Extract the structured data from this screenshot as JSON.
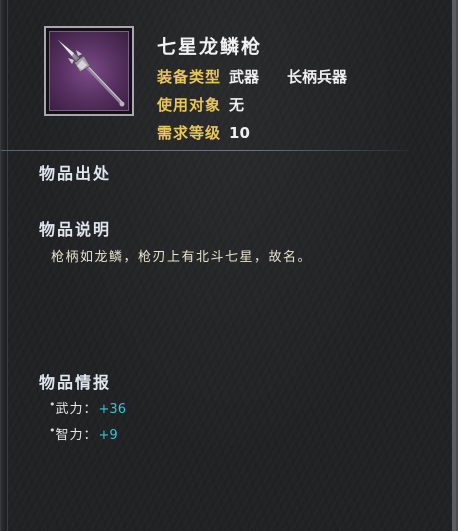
{
  "item": {
    "name": "七星龙鳞枪",
    "icon": "spear-icon",
    "frame_color": "#a9a6b0",
    "icon_bg_color": "#55305f"
  },
  "attributes": [
    {
      "label": "装备类型",
      "value": "武器",
      "value2": "长柄兵器"
    },
    {
      "label": "使用对象",
      "value": "无"
    },
    {
      "label": "需求等级",
      "value": "10"
    }
  ],
  "sections": {
    "source_title": "物品出处",
    "desc_title": "物品说明",
    "description": "枪柄如龙鳞，枪刃上有北斗七星，故名。",
    "info_title": "物品情报"
  },
  "stats": [
    {
      "bullet": "•",
      "name": "武力",
      "colon": "：",
      "value": "+36"
    },
    {
      "bullet": "•",
      "name": "智力",
      "colon": "：",
      "value": "+9"
    }
  ],
  "colors": {
    "label": "#e9c65b",
    "stat_value": "#33c6d9",
    "section_title": "#dfe6f0"
  }
}
